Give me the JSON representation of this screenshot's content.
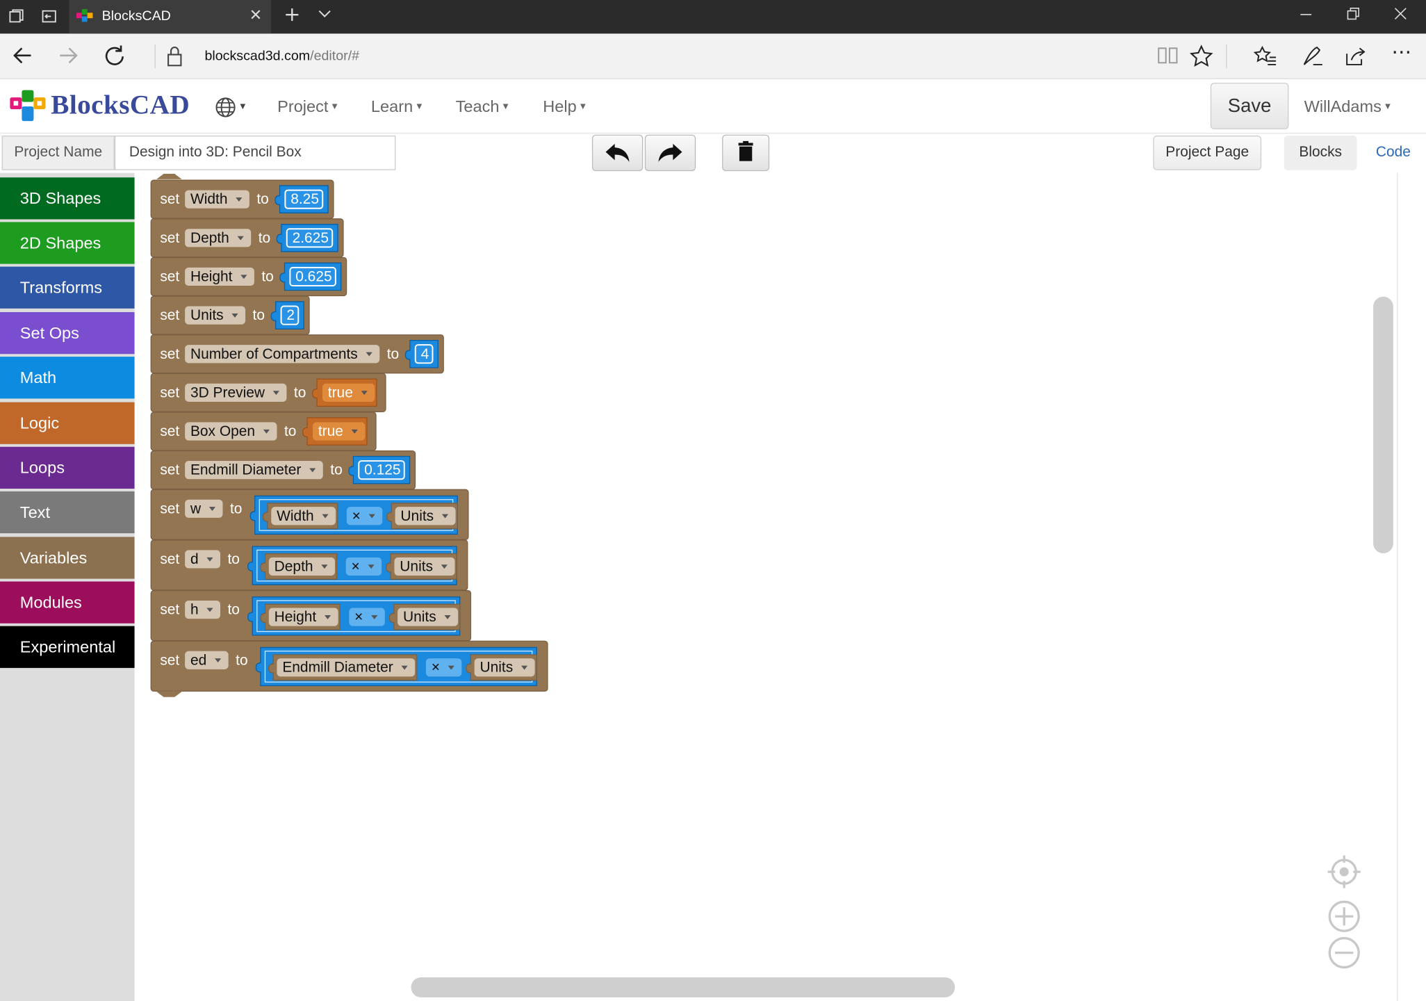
{
  "browser": {
    "tab_title": "BlocksCAD",
    "url_host": "blockscad3d.com",
    "url_path": "/editor/#",
    "icons": [
      "tab-actions-icon",
      "set-aside-tabs-icon",
      "close-icon",
      "new-tab-icon",
      "tab-preview-icon",
      "minimize-icon",
      "restore-icon",
      "close-window-icon",
      "back-icon",
      "forward-icon",
      "refresh-icon",
      "lock-icon",
      "reading-view-icon",
      "favorite-star-icon",
      "favorites-hub-icon",
      "web-note-icon",
      "share-icon",
      "more-icon"
    ]
  },
  "header": {
    "logo_text": "BlocksCAD",
    "menu": [
      "Project",
      "Learn",
      "Teach",
      "Help"
    ],
    "save_label": "Save",
    "user": "WillAdams"
  },
  "project": {
    "name_label": "Project Name",
    "name_value": "Design into 3D: Pencil Box",
    "project_page_label": "Project Page",
    "tab_blocks": "Blocks",
    "tab_code": "Code"
  },
  "categories": [
    {
      "label": "3D Shapes",
      "color": "#006b20"
    },
    {
      "label": "2D Shapes",
      "color": "#1e9c20"
    },
    {
      "label": "Transforms",
      "color": "#2e57a6"
    },
    {
      "label": "Set Ops",
      "color": "#7b4ecf"
    },
    {
      "label": "Math",
      "color": "#0d8be0"
    },
    {
      "label": "Logic",
      "color": "#c0682a"
    },
    {
      "label": "Loops",
      "color": "#6b2a8f"
    },
    {
      "label": "Text",
      "color": "#7a7a7a"
    },
    {
      "label": "Variables",
      "color": "#8c7150"
    },
    {
      "label": "Modules",
      "color": "#9c0e5c"
    },
    {
      "label": "Experimental",
      "color": "#000000"
    }
  ],
  "colors": {
    "variable_block": "#947552",
    "math_block": "#1a89de",
    "logic_block": "#c26a26",
    "field_bg": "#d4c6b3",
    "number_field": "#2a93e6"
  },
  "blocks": {
    "set_word": "set",
    "to_word": "to",
    "simple": [
      {
        "var": "Width",
        "type": "number",
        "value": "8.25"
      },
      {
        "var": "Depth",
        "type": "number",
        "value": "2.625"
      },
      {
        "var": "Height",
        "type": "number",
        "value": "0.625"
      },
      {
        "var": "Units",
        "type": "number",
        "value": "2"
      },
      {
        "var": "Number of Compartments",
        "type": "number",
        "value": "4"
      },
      {
        "var": "3D Preview",
        "type": "bool",
        "value": "true"
      },
      {
        "var": "Box Open",
        "type": "bool",
        "value": "true"
      },
      {
        "var": "Endmill Diameter",
        "type": "number",
        "value": "0.125"
      }
    ],
    "arith": [
      {
        "var": "w",
        "a": "Width",
        "op": "×",
        "b": "Units"
      },
      {
        "var": "d",
        "a": "Depth",
        "op": "×",
        "b": "Units"
      },
      {
        "var": "h",
        "a": "Height",
        "op": "×",
        "b": "Units"
      },
      {
        "var": "ed",
        "a": "Endmill Diameter",
        "op": "×",
        "b": "Units"
      }
    ]
  },
  "workspace_controls": [
    "recenter-icon",
    "zoom-in-icon",
    "zoom-out-icon"
  ]
}
